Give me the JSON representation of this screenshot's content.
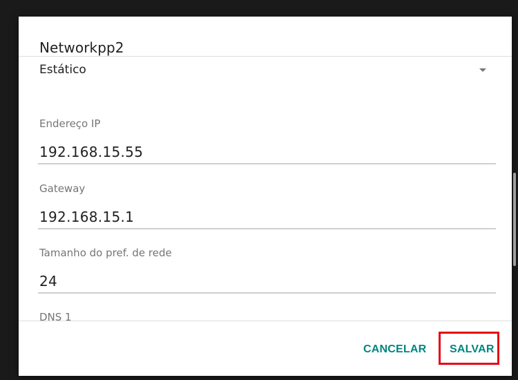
{
  "dialog": {
    "title": "Networkpp2",
    "ip_mode": {
      "selected": "Estático",
      "icon": "dropdown-arrow-icon"
    },
    "fields": [
      {
        "label": "Endereço IP",
        "value": "192.168.15.55"
      },
      {
        "label": "Gateway",
        "value": "192.168.15.1"
      },
      {
        "label": "Tamanho do pref. de rede",
        "value": "24"
      },
      {
        "label": "DNS 1",
        "value": ""
      }
    ],
    "actions": {
      "cancel_label": "CANCELAR",
      "save_label": "SALVAR"
    }
  },
  "colors": {
    "accent": "#00857e",
    "highlight_border": "#e30613",
    "label": "#757575",
    "text": "#212121"
  }
}
